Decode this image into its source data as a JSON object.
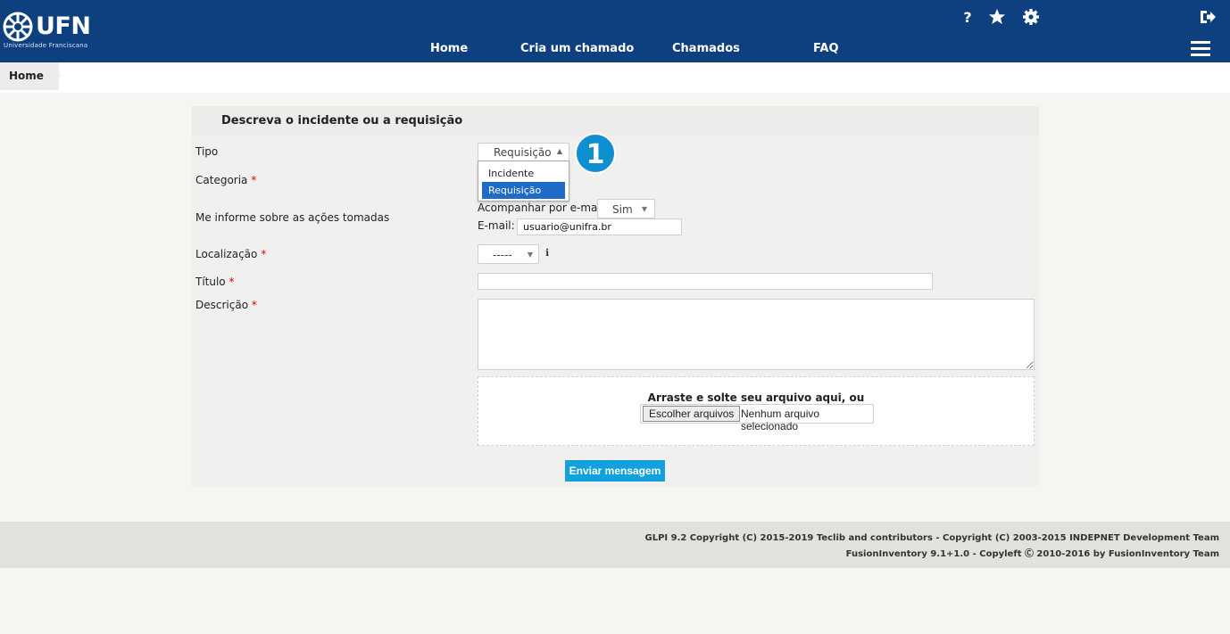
{
  "header": {
    "logo_text": "UFN",
    "logo_subtitle": "Universidade Franciscana",
    "nav": [
      "Home",
      "Cria um chamado",
      "Chamados",
      "FAQ"
    ],
    "icons": [
      "help-icon",
      "star-icon",
      "gear-icon",
      "logout-icon",
      "menu-icon"
    ],
    "colors": {
      "bar": "#0e4080",
      "accent": "#12a1dc"
    }
  },
  "breadcrumb": {
    "current": "Home"
  },
  "form": {
    "title": "Descreva o incidente ou a requisição",
    "tipo": {
      "label": "Tipo",
      "value": "Requisição",
      "options": [
        "Incidente",
        "Requisição"
      ],
      "selected_option": "Requisição"
    },
    "badge": "1",
    "categoria": {
      "label": "Categoria",
      "required_mark": "*"
    },
    "informe": {
      "label": "Me informe sobre as ações tomadas",
      "follow_label": "Acompanhar por e-mail",
      "follow_value": "Sim",
      "email_label": "E-mail:",
      "email_value": "usuario@unifra.br"
    },
    "localizacao": {
      "label": "Localização",
      "required_mark": "*",
      "value": "-----"
    },
    "titulo": {
      "label": "Título",
      "required_mark": "*",
      "value": ""
    },
    "descricao": {
      "label": "Descrição",
      "required_mark": "*",
      "value": ""
    },
    "upload": {
      "prompt": "Arraste e solte seu arquivo aqui, ou",
      "button": "Escolher arquivos",
      "status": "Nenhum arquivo selecionado"
    },
    "submit": "Enviar mensagem"
  },
  "footer": {
    "line1": "GLPI 9.2 Copyright (C) 2015-2019 Teclib and contributors - Copyright (C) 2003-2015 INDEPNET Development Team",
    "line2": "FusionInventory 9.1+1.0 - Copyleft Ⓒ 2010-2016 by FusionInventory Team"
  }
}
